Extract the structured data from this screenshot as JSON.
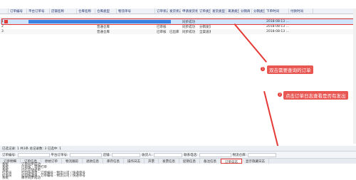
{
  "grid": {
    "headers": [
      "",
      "订单编号",
      "平台订单号",
      "店铺名称",
      "仓库名称",
      "仓库类型",
      "物流单号",
      "订单状态",
      "发货状态",
      "申请发货状态",
      "订单类型",
      "发货类型",
      "来源类型",
      "分销商",
      "分销类型",
      "下单时间",
      "付款时间"
    ],
    "rows": [
      {
        "num": "1",
        "cells": [
          "",
          "",
          "",
          "",
          "普通仓库",
          "",
          "已审核",
          "",
          "同步成功",
          "",
          "",
          "",
          "",
          "",
          "2018-08-13 ..."
        ]
      },
      {
        "num": "2",
        "cells": [
          "",
          "",
          "",
          "",
          "普通仓库",
          "",
          "已审核",
          "",
          "同步成功",
          "分销发货",
          "",
          "",
          "",
          "",
          "2018-08-13 ..."
        ]
      },
      {
        "num": "3",
        "cells": [
          "",
          "",
          "",
          "",
          "普通仓库",
          "",
          "已审核",
          "已出库",
          "同步成功",
          "全渠道发货",
          "",
          "",
          "",
          "",
          "2018-08-13 ..."
        ]
      }
    ]
  },
  "annotations": {
    "step1_num": "1",
    "step1_text": "双击需要查询的订单",
    "step2_num": "2",
    "step2_text": "点击订单日志查看是否有发出"
  },
  "status": {
    "text": "已选记录: 1   共3条   总记录数: 3   已选中: 1"
  },
  "detail": {
    "order_label": "订单编号:",
    "platform_label": "平台订单号:",
    "store_label": "店铺:",
    "receiver_label": "收货人:",
    "phone_label": "联系电话:",
    "warehouse_label": "物流仓库:"
  },
  "tabs": [
    "订单明细",
    "订单信息",
    "原始订单",
    "物流跟踪",
    "退款信息",
    "库存信息",
    "操作日志",
    "开票",
    "发票信息",
    "促销信息",
    "备注信息",
    "订单日志",
    "显示隐藏日志"
  ],
  "log": {
    "rows": [
      {
        "t": "系统",
        "v": "订单同步成功"
      },
      {
        "t": "系统",
        "v": "已审核 - 等待打单"
      },
      {
        "t": "系统",
        "v": "已打印快递单"
      },
      {
        "t": "打单员",
        "v": "打印快递单 - 订单编号 - 物流公司 / 快递单号"
      },
      {
        "t": "打单员",
        "v": "打印快递单 - 订单编号 - 物流公司 / 快递单号"
      },
      {
        "t": "系统",
        "v": "库存同步成功"
      }
    ]
  },
  "colors": {
    "accent": "#e53935",
    "selected_row": "#cfe3fb"
  }
}
